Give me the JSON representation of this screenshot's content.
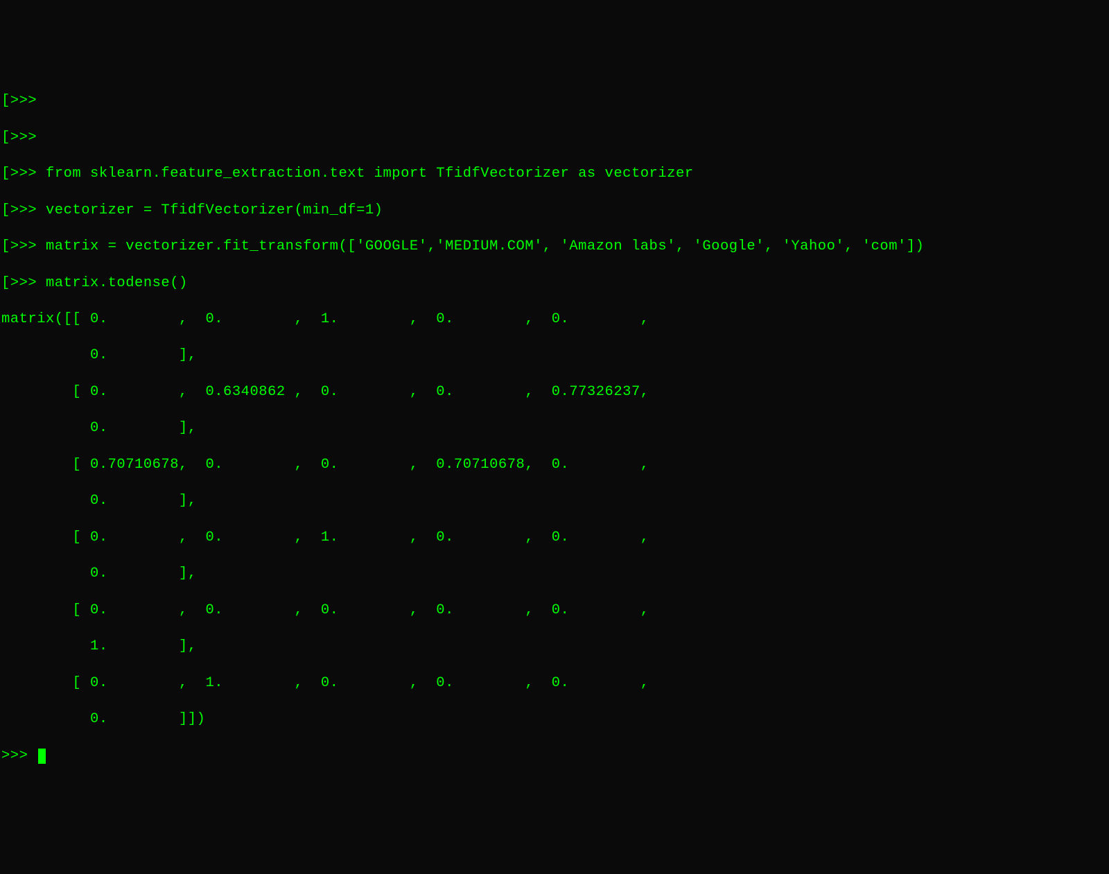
{
  "terminal": {
    "prompt": "[>>> ",
    "prompt_short": "[>>>",
    "cursor_prompt": ">>> ",
    "lines": {
      "l0": "[>>>",
      "l1": "[>>>",
      "l2": "[>>> from sklearn.feature_extraction.text import TfidfVectorizer as vectorizer",
      "l3": "[>>> vectorizer = TfidfVectorizer(min_df=1)",
      "l4": "[>>> matrix = vectorizer.fit_transform(['GOOGLE','MEDIUM.COM', 'Amazon labs', 'Google', 'Yahoo', 'com'])",
      "l5": "[>>> matrix.todense()",
      "l6": "matrix([[ 0.        ,  0.        ,  1.        ,  0.        ,  0.        ,",
      "l7": "          0.        ],",
      "l8": "        [ 0.        ,  0.6340862 ,  0.        ,  0.        ,  0.77326237,",
      "l9": "          0.        ],",
      "l10": "        [ 0.70710678,  0.        ,  0.        ,  0.70710678,  0.        ,",
      "l11": "          0.        ],",
      "l12": "        [ 0.        ,  0.        ,  1.        ,  0.        ,  0.        ,",
      "l13": "          0.        ],",
      "l14": "        [ 0.        ,  0.        ,  0.        ,  0.        ,  0.        ,",
      "l15": "          1.        ],",
      "l16": "        [ 0.        ,  1.        ,  0.        ,  0.        ,  0.        ,",
      "l17": "          0.        ]])",
      "l18": ">>> "
    }
  }
}
